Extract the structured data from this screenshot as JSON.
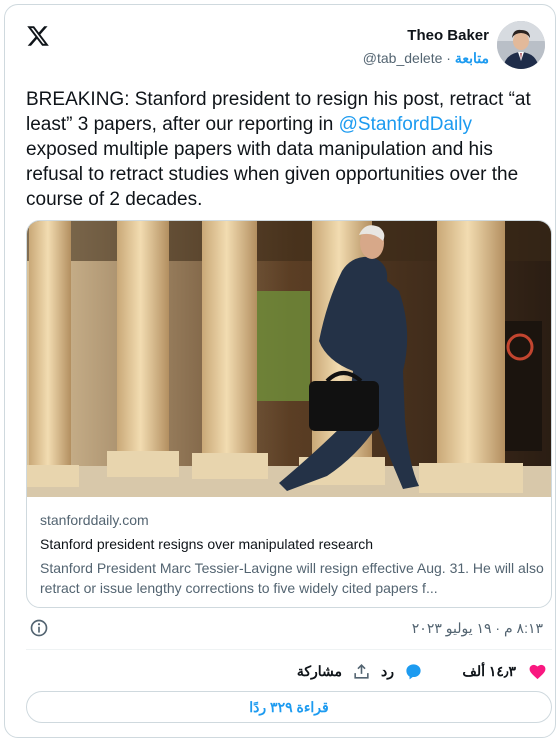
{
  "author": {
    "name": "Theo Baker",
    "handle": "@tab_delete",
    "follow_label": "متابعة",
    "separator": "·"
  },
  "tweet": {
    "text_before": "BREAKING: Stanford president to resign his post, retract “at least” 3 papers, after our reporting in ",
    "mention": "@StanfordDaily",
    "text_after": " exposed multiple papers with data manipulation and his refusal to retract studies when given opportunities over the course of 2 decades."
  },
  "link_card": {
    "domain": "stanforddaily.com",
    "title": "Stanford president resigns over manipulated research",
    "description": "Stanford President Marc Tessier-Lavigne will resign effective Aug. 31. He will also retract or issue lengthy corrections to five widely cited papers f..."
  },
  "timestamp": "٨:١٣ م · ١٩ يوليو ٢٠٢٣",
  "actions": {
    "likes_count": "١٤٫٣ ألف",
    "reply_label": "رد",
    "share_label": "مشاركة"
  },
  "read_replies_label": "قراءة ٣٢٩ ردًا",
  "colors": {
    "accent": "#1d9bf0",
    "like": "#f91880",
    "muted": "#536471"
  },
  "icons": [
    "x-logo-icon",
    "info-icon",
    "heart-icon",
    "reply-icon",
    "share-icon"
  ]
}
